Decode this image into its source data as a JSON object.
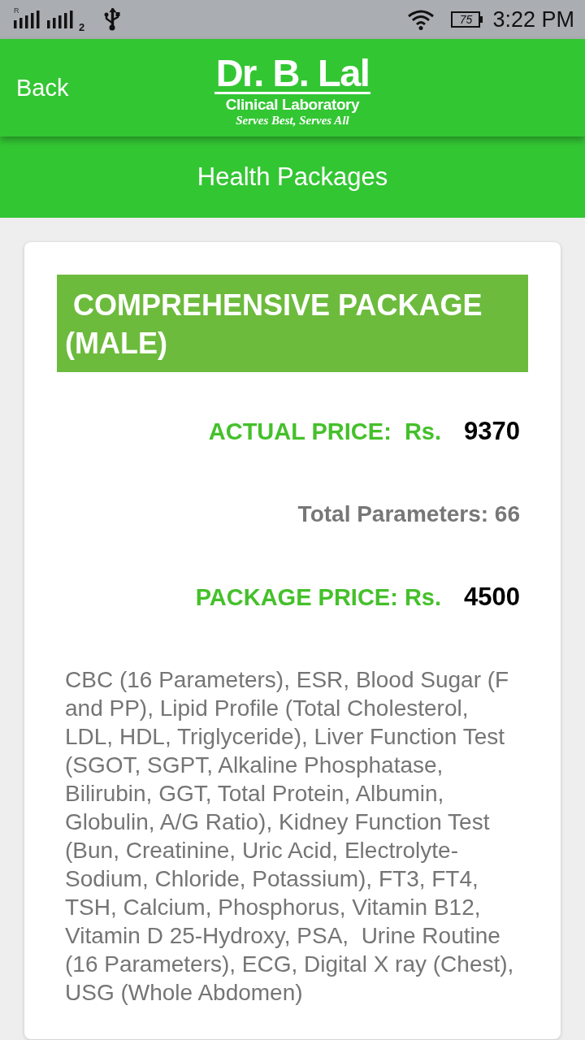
{
  "status_bar": {
    "roaming": "R",
    "sim_slot": "2",
    "battery": "75",
    "time": "3:22 PM"
  },
  "app_bar": {
    "back": "Back",
    "logo": {
      "title": "Dr. B. Lal",
      "subtitle": "Clinical Laboratory",
      "tagline": "Serves Best, Serves All"
    }
  },
  "page_title": "Health Packages",
  "package": {
    "title": "COMPREHENSIVE PACKAGE (MALE)",
    "rows": [
      {
        "kind": "price",
        "label": "ACTUAL PRICE:  Rs.",
        "value": "9370"
      },
      {
        "kind": "info",
        "text": "Total Parameters: 66"
      },
      {
        "kind": "price",
        "label": "PACKAGE PRICE: Rs.",
        "value": "4500"
      }
    ],
    "description": "CBC (16 Parameters), ESR, Blood Sugar (F and PP), Lipid Profile (Total Cholesterol, LDL, HDL, Triglyceride), Liver Function Test (SGOT, SGPT, Alkaline Phosphatase, Bilirubin, GGT, Total Protein, Albumin, Globulin, A/G Ratio), Kidney Function Test (Bun, Creatinine, Uric Acid, Electrolyte-Sodium, Chloride, Potassium), FT3, FT4, TSH, Calcium, Phosphorus, Vitamin B12, Vitamin D 25-Hydroxy, PSA,  Urine Routine (16 Parameters), ECG, Digital X ray (Chest), USG (Whole Abdomen)"
  }
}
